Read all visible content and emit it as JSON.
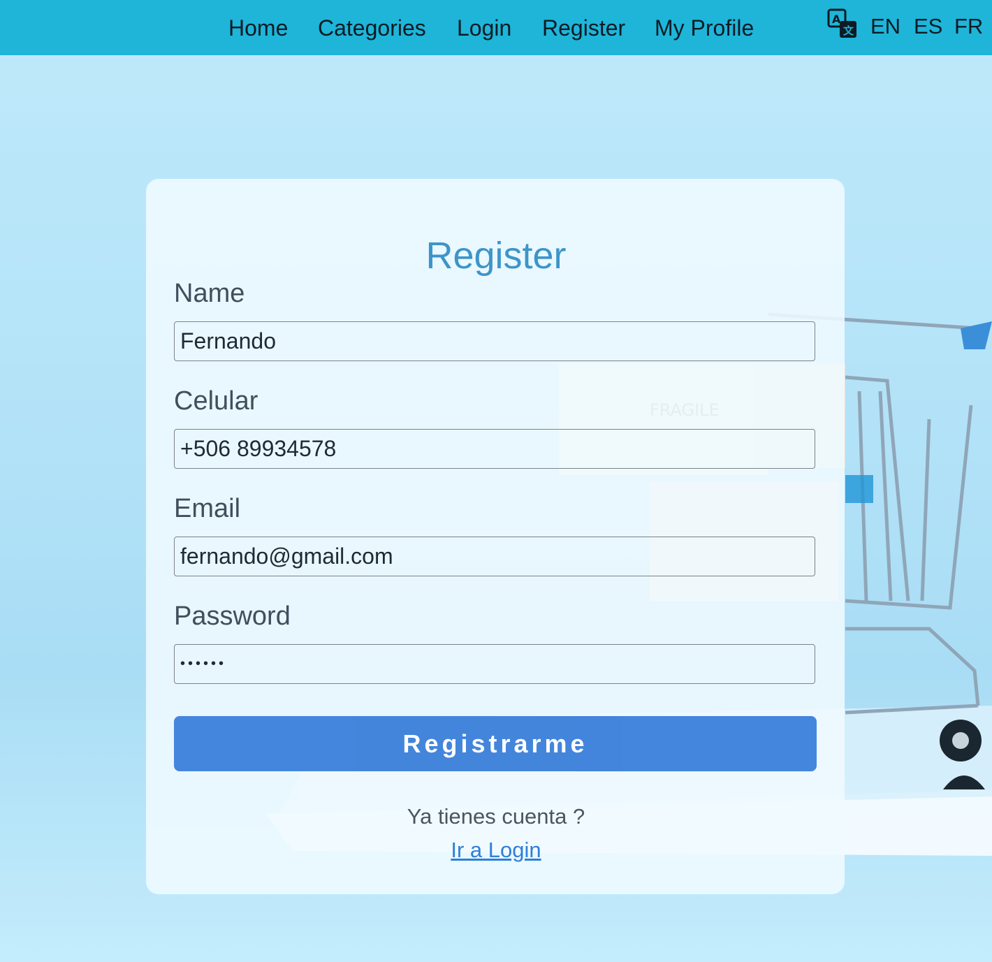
{
  "nav": {
    "links": [
      "Home",
      "Categories",
      "Login",
      "Register",
      "My Profile"
    ],
    "languages": [
      "EN",
      "ES",
      "FR"
    ],
    "language_icon": "translate-icon"
  },
  "form": {
    "title": "Register",
    "fields": [
      {
        "label": "Name",
        "value": "Fernando",
        "type": "text"
      },
      {
        "label": "Celular",
        "value": "+506 89934578",
        "type": "tel"
      },
      {
        "label": "Email",
        "value": "fernando@gmail.com",
        "type": "email"
      },
      {
        "label": "Password",
        "value": "••••••",
        "type": "password"
      }
    ],
    "submit_label": "Registrarme",
    "has_account_text": "Ya tienes cuenta ?",
    "login_link_label": "Ir a Login"
  },
  "colors": {
    "nav_bg": "#1eb5d9",
    "title": "#3d95c8",
    "button_bg": "#3b7fdb",
    "link": "#2f7fd6"
  }
}
